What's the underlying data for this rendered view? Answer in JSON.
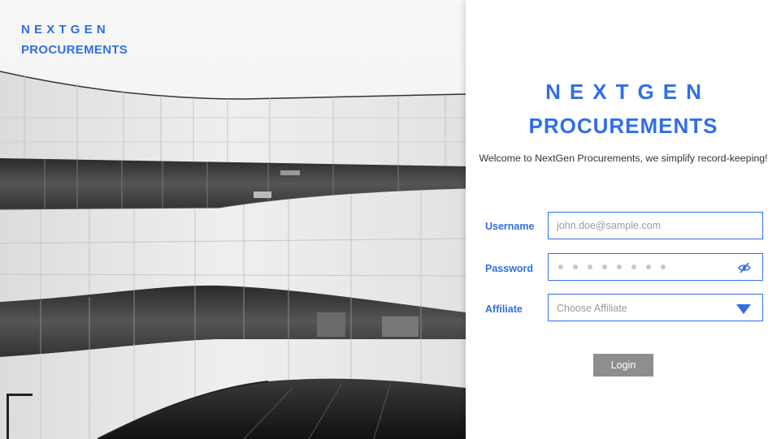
{
  "hero": {
    "brand_line1": "NEXTGEN",
    "brand_line2": "PROCUREMENTS"
  },
  "panel": {
    "brand_line1": "NEXTGEN",
    "brand_line2": "PROCUREMENTS",
    "welcome": "Welcome to NextGen Procurements, we simplify record-keeping!"
  },
  "form": {
    "username_label": "Username",
    "username_placeholder": "john.doe@sample.com",
    "password_label": "Password",
    "password_icon": "eye-slash-icon",
    "affiliate_label": "Affiliate",
    "affiliate_value": "Choose Affiliate",
    "affiliate_icon": "chevron-down-icon",
    "login_label": "Login"
  },
  "colors": {
    "accent": "#2f6fe6",
    "button": "#8e8e8e"
  }
}
